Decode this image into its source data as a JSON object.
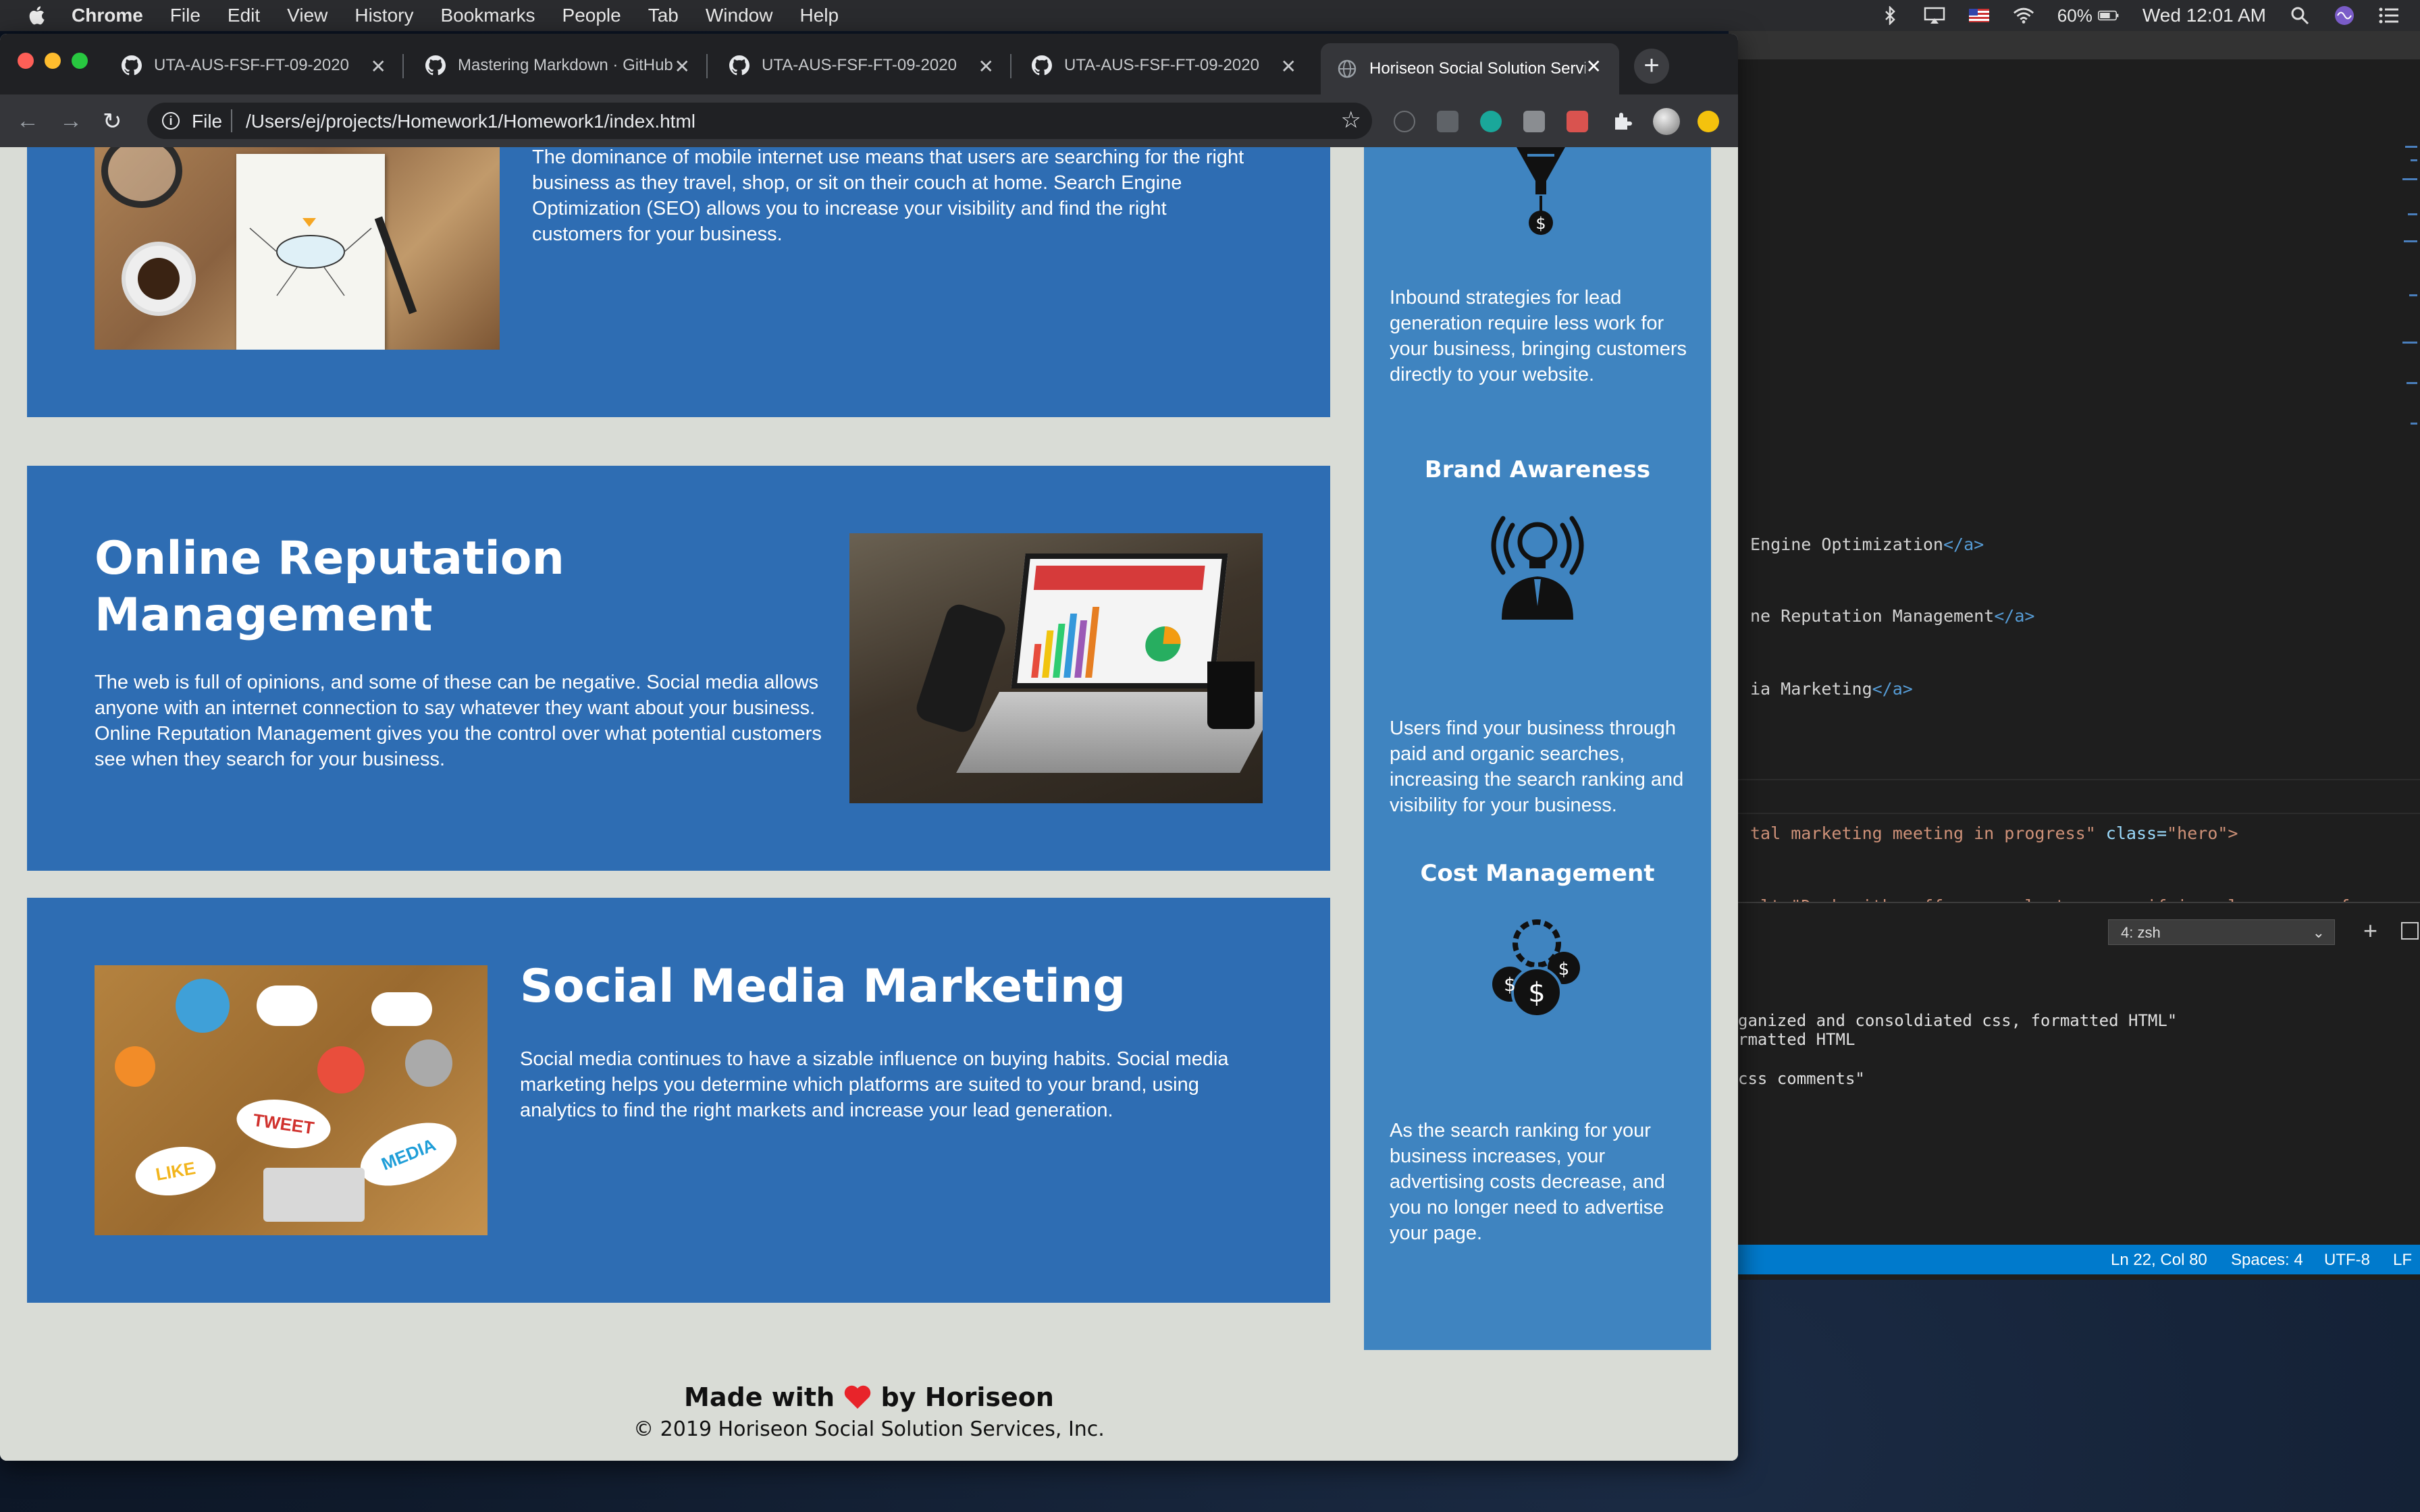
{
  "menubar": {
    "app_name": "Chrome",
    "menus": [
      "File",
      "Edit",
      "View",
      "History",
      "Bookmarks",
      "People",
      "Tab",
      "Window",
      "Help"
    ],
    "battery": "60%",
    "clock": "Wed 12:01 AM"
  },
  "browser": {
    "tabs": [
      {
        "title": "UTA-AUS-FSF-FT-09-2020",
        "favicon": "github-icon"
      },
      {
        "title": "Mastering Markdown · GitHub",
        "favicon": "github-icon"
      },
      {
        "title": "UTA-AUS-FSF-FT-09-2020",
        "favicon": "github-icon"
      },
      {
        "title": "UTA-AUS-FSF-FT-09-2020",
        "favicon": "github-icon"
      },
      {
        "title": "Horiseon Social Solution Services",
        "favicon": "globe-icon",
        "active": true
      }
    ],
    "omnibox": {
      "scheme_label": "File",
      "url": "/Users/ej/projects/Homework1/Homework1/index.html"
    }
  },
  "page": {
    "seo": {
      "text": "The dominance of mobile internet use means that users are searching for the right business as they travel, shop, or sit on their couch at home. Search Engine Optimization (SEO) allows you to increase your visibility and find the right customers for your business."
    },
    "reputation": {
      "heading": "Online Reputation Management",
      "text": "The web is full of opinions, and some of these can be negative. Social media allows anyone with an internet connection to say whatever they want about your business. Online Reputation Management gives you the control over what potential customers see when they search for your business."
    },
    "social": {
      "heading": "Social Media Marketing",
      "text": "Social media continues to have a sizable influence on buying habits. Social media marketing helps you determine which platforms are suited to your brand, using analytics to find the right markets and increase your lead generation."
    },
    "aside": {
      "lead_text": "Inbound strategies for lead generation require less work for your business, bringing customers directly to your website.",
      "brand_heading": "Brand Awareness",
      "brand_text": "Users find your business through paid and organic searches, increasing the search ranking and visibility for your business.",
      "cost_heading": "Cost Management",
      "cost_text": "As the search ranking for your business increases, your advertising costs decrease, and you no longer need to advertise your page."
    },
    "footer": {
      "made_prefix": "Made with",
      "made_suffix": "by Horiseon",
      "copyright": "© 2019 Horiseon Social Solution Services, Inc."
    }
  },
  "editor": {
    "code_lines": [
      {
        "text": "Engine Optimization",
        "tag": "</a>"
      },
      {
        "text": "ne Reputation Management",
        "tag": "</a>"
      },
      {
        "text": "ia Marketing",
        "tag": "</a>"
      },
      {
        "text": "tal marketing meeting in progress\"",
        "attr": " class=",
        "str": "\"hero\">"
      },
      {
        "text": "alt=\"Desk with coffee cup, laptop, magnifying glass, cup of pens, a"
      }
    ],
    "terminal_select": "4: zsh",
    "terminal_lines": [
      "ganized and consoldiated css, formatted HTML\"",
      "rmatted HTML",
      "css comments\""
    ],
    "status": {
      "position": "Ln 22, Col 80",
      "spaces": "Spaces: 4",
      "encoding": "UTF-8",
      "eol": "LF"
    }
  },
  "colors": {
    "card_blue": "#2e6db3",
    "aside_blue": "#3f84c0",
    "page_bg": "#d9dcd6",
    "status_blue": "#007acc"
  }
}
